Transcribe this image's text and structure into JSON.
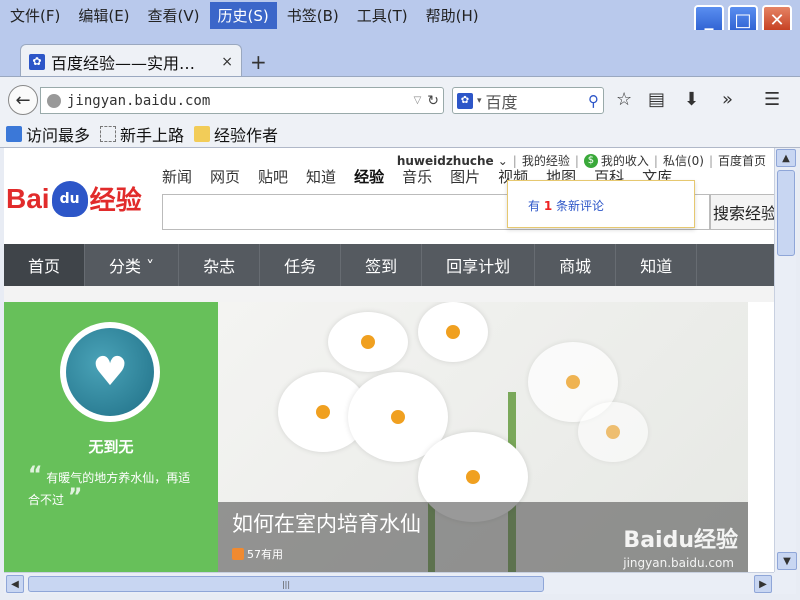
{
  "menu": [
    "文件(F)",
    "编辑(E)",
    "查看(V)",
    "历史(S)",
    "书签(B)",
    "工具(T)",
    "帮助(H)"
  ],
  "tab": {
    "title": "百度经验——实用…",
    "close": "×",
    "new": "+"
  },
  "nav": {
    "url": "jingyan.baidu.com",
    "search_placeholder": "百度"
  },
  "bookmarks": [
    "访问最多",
    "新手上路",
    "经验作者"
  ],
  "site": {
    "user": {
      "name": "huweidzhuche",
      "my_exp": "我的经验",
      "income": "我的收入",
      "msg": "私信(0)",
      "home": "百度首页"
    },
    "logo": {
      "bai": "Bai",
      "du": "du",
      "jy": "经验"
    },
    "topnav": [
      "新闻",
      "网页",
      "贴吧",
      "知道",
      "经验",
      "音乐",
      "图片",
      "视频",
      "地图",
      "百科",
      "文库"
    ],
    "search_btn": "搜索经验",
    "notice": {
      "pre": "有 ",
      "num": "1",
      "post": " 条新评论"
    },
    "mainnav": [
      "首页",
      "分类 ˅",
      "杂志",
      "任务",
      "签到",
      "回享计划",
      "商城",
      "知道"
    ],
    "author": {
      "name": "无到无",
      "quote": "有暖气的地方养水仙，再适合不过"
    },
    "hero": {
      "title": "如何在室内培育水仙",
      "likes": "57有用",
      "wm": "Baidu经验",
      "wm_url": "jingyan.baidu.com"
    }
  }
}
